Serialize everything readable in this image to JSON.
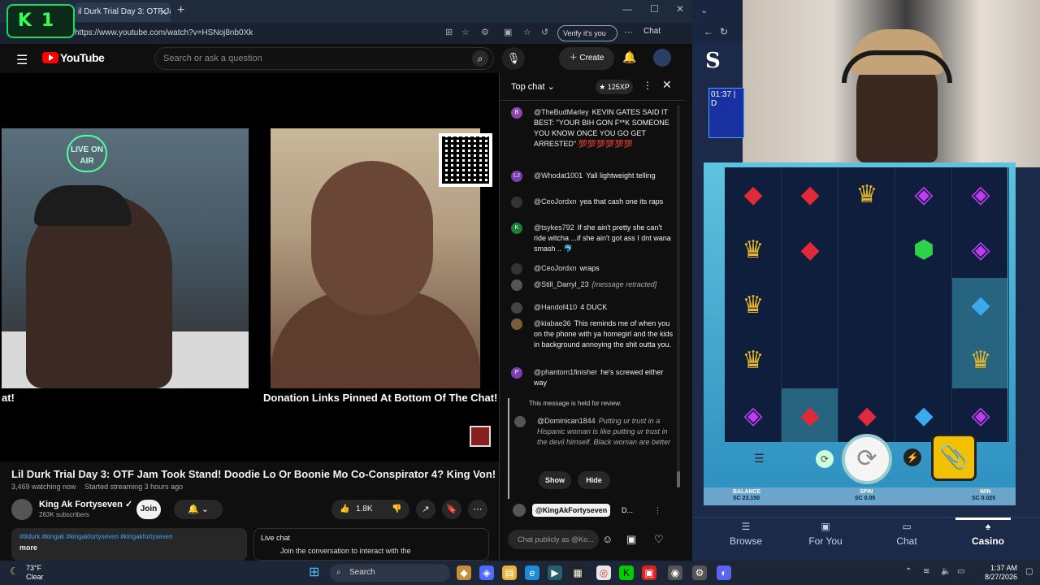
{
  "browser": {
    "tab_title": "il Durk Trial Day 3: OTF Jam",
    "url": "https://www.youtube.com/watch?v=HSNoj8nb0Xk",
    "verify_label": "Verify it's you",
    "chat_label": "Chat",
    "logo_text": "K1"
  },
  "youtube": {
    "logo_word": "YouTube",
    "search_placeholder": "Search or ask a question",
    "create_label": "Create"
  },
  "video": {
    "caption_left": "at!",
    "caption_right": "Donation Links Pinned At Bottom Of The Chat!",
    "live_sign": "LIVE ON AIR",
    "title": "Lil Durk Trial Day 3: OTF Jam Took Stand! Doodie Lo Or Boonie Mo Co-Conspirator 4? King Von! TRL!",
    "watching": "3,469 watching now",
    "started": "Started streaming 3 hours ago",
    "channel_name": "King Ak Fortyseven",
    "subscribers": "263K subscribers",
    "join_label": "Join",
    "likes": "1.8K",
    "hashtags": "#lildurk #kingak #kingakfortyseven #kingakfortyseven",
    "more_label": "more",
    "live_chat_title": "Live chat",
    "live_chat_sub": "Join the conversation to interact with the"
  },
  "chat": {
    "title": "Top chat",
    "xp": "125XP",
    "messages": [
      {
        "initial": "B",
        "author": "@TheBudMarley",
        "text": "KEVIN GATES SAID IT BEST: \"YOUR BIH GON F**K SOMEONE YOU KNOW ONCE YOU GO GET ARRESTED\" 💯💯💯💯💯💯",
        "color": "#8e44ad"
      },
      {
        "initial": "LJ",
        "author": "@Whodat1001",
        "text": "Yall lightweight telling",
        "color": "#7b3fb0"
      },
      {
        "initial": "",
        "author": "@CeoJordxn",
        "text": "yea that cash one its raps",
        "color": "#333"
      },
      {
        "initial": "K",
        "author": "@tsykes792",
        "text": "If she ain't pretty she can't ride witcha ...if she ain't got ass I dnt wana smash .. 🐬",
        "color": "#1e7d3a"
      },
      {
        "initial": "",
        "author": "@CeoJordxn",
        "text": "wraps",
        "color": "#333"
      },
      {
        "initial": "",
        "author": "@Still_Darryl_23",
        "text": "[message retracted]",
        "color": "#555"
      },
      {
        "initial": "",
        "author": "@Handof410",
        "text": "4 DUCK",
        "color": "#444"
      },
      {
        "initial": "",
        "author": "@kiabae36",
        "text": "This reminds me of when you on the phone with ya homegirl and the kids in background annoying the shit outta you.",
        "color": "#7a5c3a"
      },
      {
        "initial": "P",
        "author": "@phantom1finisher",
        "text": "he's screwed either way",
        "color": "#7b3fb0"
      }
    ],
    "held_note": "This message is held for review.",
    "held_author": "@Dominican1844",
    "held_text": "Putting ur trust in a Hispanic woman is like putting ur trust in the devil himself. Black woman are better",
    "show_label": "Show",
    "hide_label": "Hide",
    "current_user": "@KingAkFortyseven",
    "current_user_suffix": "D...",
    "input_placeholder": "Chat publicly as @Ko..."
  },
  "game": {
    "timer": "01:37 | D",
    "balance_label": "BALANCE",
    "balance_value": "SC 23.150",
    "spin_label": "SPIN",
    "spin_value": "SC 0.05",
    "win_label": "WIN",
    "win_value": "SC 0.025",
    "reels": [
      [
        "red",
        "gold",
        "gold",
        "gold",
        "purple"
      ],
      [
        "red",
        "red",
        "",
        "",
        "red"
      ],
      [
        "gold",
        "",
        "",
        "",
        "red"
      ],
      [
        "purple",
        "green",
        "",
        "",
        "blue"
      ],
      [
        "purple",
        "purple",
        "blue",
        "gold",
        "purple"
      ]
    ]
  },
  "nav": {
    "items": [
      "Browse",
      "For You",
      "Chat",
      "Casino"
    ],
    "active": "Casino"
  },
  "taskbar": {
    "temp": "73°F",
    "weather": "Clear",
    "search_label": "Search",
    "time": "1:37 AM",
    "date": "8/27/2026"
  }
}
